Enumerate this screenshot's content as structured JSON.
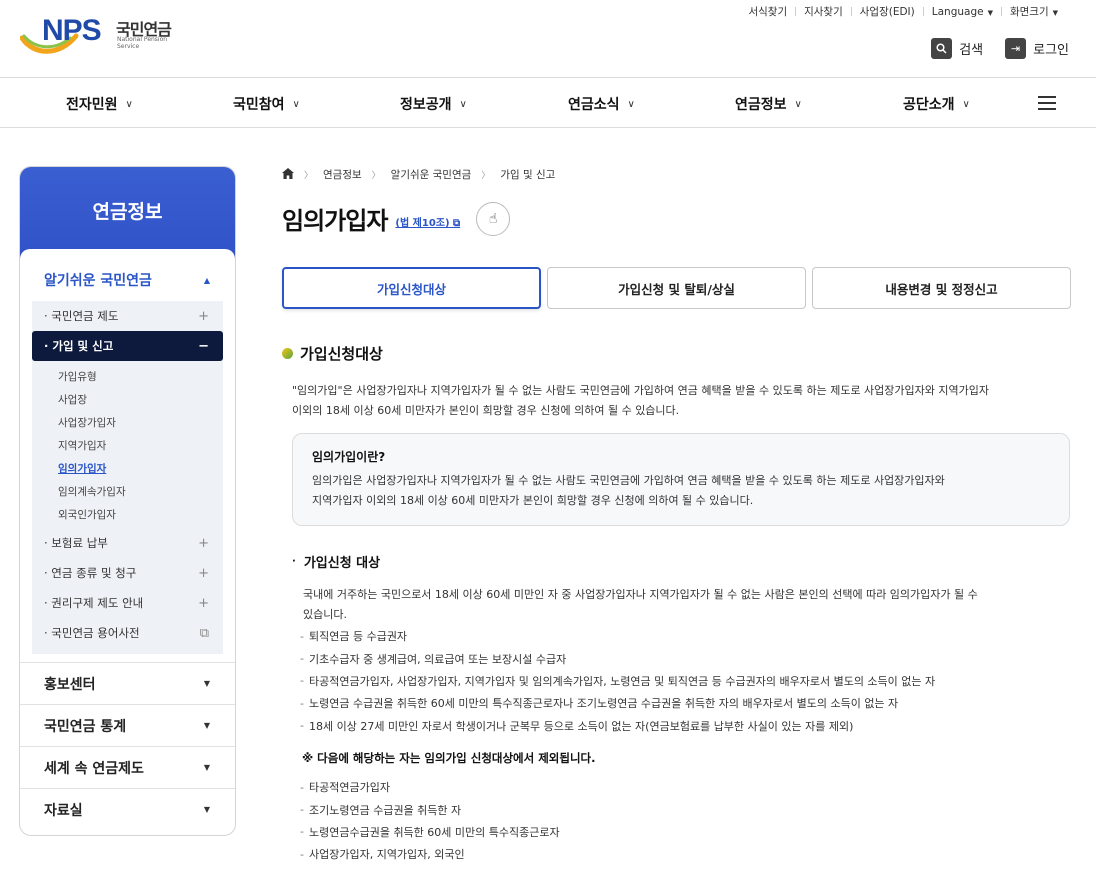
{
  "header": {
    "logo_nps": "NPS",
    "logo_kr": "국민연금",
    "logo_en": "National Pension Service",
    "util": [
      "서식찾기",
      "지사찾기",
      "사업장(EDI)",
      "Language",
      "화면크기"
    ],
    "search_label": "검색",
    "login_label": "로그인"
  },
  "gnb": [
    "전자민원",
    "국민참여",
    "정보공개",
    "연금소식",
    "연금정보",
    "공단소개"
  ],
  "sidebar": {
    "title": "연금정보",
    "section_active": "알기쉬운 국민연금",
    "items": [
      {
        "label": "· 국민연금 제도",
        "icon": "+"
      },
      {
        "label": "· 가입 및 신고",
        "icon": "−"
      }
    ],
    "sub_items": [
      "가입유형",
      "사업장",
      "사업장가입자",
      "지역가입자",
      "임의가입자",
      "임의계속가입자",
      "외국인가입자"
    ],
    "items_after": [
      {
        "label": "· 보험료 납부",
        "icon": "+"
      },
      {
        "label": "· 연금 종류 및 청구",
        "icon": "+"
      },
      {
        "label": "· 권리구제 제도 안내",
        "icon": "+"
      },
      {
        "label": "· 국민연금 용어사전",
        "icon": "⧉"
      }
    ],
    "bottom": [
      "홍보센터",
      "국민연금 통계",
      "세계 속 연금제도",
      "자료실"
    ]
  },
  "breadcrumb": [
    "연금정보",
    "알기쉬운 국민연금",
    "가입 및 신고"
  ],
  "page": {
    "title": "임의가입자",
    "law_link": "(법 제10조)",
    "tabs": [
      "가입신청대상",
      "가입신청 및 탈퇴/상실",
      "내용변경 및 정정신고"
    ],
    "section_title": "가입신청대상",
    "intro": [
      "\"임의가입\"은 사업장가입자나 지역가입자가 될 수 없는 사람도 국민연금에 가입하여 연금 혜택을 받을 수 있도록 하는 제도로 사업장가입자와 지역가입자",
      "이외의 18세 이상 60세 미만자가 본인이 희망할 경우 신청에 의하여 될 수 있습니다."
    ],
    "box_title": "임의가입이란?",
    "box_text": [
      "임의가입은 사업장가입자나 지역가입자가 될 수 없는 사람도 국민연금에 가입하여 연금 혜택을 받을 수 있도록 하는 제도로 사업장가입자와",
      "지역가입자 이외의 18세 이상 60세 미만자가 본인이 희망할 경우 신청에 의하여 될 수 있습니다."
    ],
    "sub_title": "가입신청 대상",
    "sub_para": [
      "국내에 거주하는 국민으로서 18세 이상 60세 미만인 자 중 사업장가입자나 지역가입자가 될 수 없는 사람은 본인의 선택에 따라 임의가입자가 될 수",
      "있습니다."
    ],
    "list1": [
      "퇴직연금 등 수급권자",
      "기초수급자 중 생계급여, 의료급여 또는 보장시설 수급자",
      "타공적연금가입자, 사업장가입자, 지역가입자 및 임의계속가입자, 노령연금 및 퇴직연금 등 수급권자의 배우자로서 별도의 소득이 없는 자",
      "노령연금 수급권을 취득한 60세 미만의 특수직종근로자나 조기노령연금 수급권을 취득한 자의 배우자로서 별도의 소득이 없는 자",
      "18세 이상 27세 미만인 자로서 학생이거나 군복무 등으로 소득이 없는 자(연금보험료를 납부한 사실이 있는 자를 제외)"
    ],
    "note": "※ 다음에 해당하는 자는 임의가입 신청대상에서 제외됩니다.",
    "list2": [
      "타공적연금가입자",
      "조기노령연금 수급권을 취득한 자",
      "노령연금수급권을 취득한 60세 미만의 특수직종근로자",
      "사업장가입자, 지역가입자, 외국인"
    ]
  }
}
